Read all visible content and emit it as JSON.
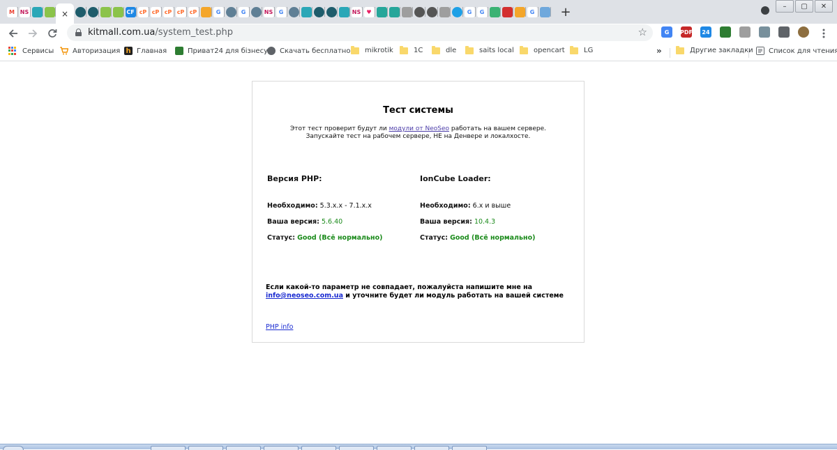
{
  "browser": {
    "active_tab_close": "×",
    "new_tab": "+",
    "window_buttons": [
      "–",
      "▢",
      "✕"
    ],
    "tabs": [
      {
        "icon": "gmail-icon",
        "letter": "M",
        "color": "#ea4335",
        "bg": "#ffffff"
      },
      {
        "icon": "ns-icon",
        "letter": "NS",
        "color": "#c2185b",
        "bg": "#ffffff"
      },
      {
        "icon": "tab-page-icon",
        "letter": "",
        "color": "#ffffff",
        "bg": "#2aa7b7"
      },
      {
        "icon": "puzzle-icon",
        "letter": "",
        "color": "#ffffff",
        "bg": "#8bc34a"
      },
      {
        "icon": "globe-icon",
        "letter": "",
        "color": "#ffffff",
        "bg": "#1e5c6b"
      },
      {
        "icon": "globe-icon",
        "letter": "",
        "color": "#ffffff",
        "bg": "#1e5c6b"
      },
      {
        "icon": "puzzle-icon",
        "letter": "",
        "color": "#ffffff",
        "bg": "#8bc34a"
      },
      {
        "icon": "puzzle-icon",
        "letter": "",
        "color": "#ffffff",
        "bg": "#8bc34a"
      },
      {
        "icon": "cr-icon",
        "letter": "CF",
        "color": "#ffffff",
        "bg": "#1e88e5"
      },
      {
        "icon": "cp-icon",
        "letter": "cP",
        "color": "#ff6c2c",
        "bg": "#ffffff"
      },
      {
        "icon": "cp-icon",
        "letter": "cP",
        "color": "#ff6c2c",
        "bg": "#ffffff"
      },
      {
        "icon": "cp-icon",
        "letter": "cP",
        "color": "#ff6c2c",
        "bg": "#ffffff"
      },
      {
        "icon": "cp-icon",
        "letter": "cP",
        "color": "#ff6c2c",
        "bg": "#ffffff"
      },
      {
        "icon": "cp-icon",
        "letter": "cP",
        "color": "#ff6c2c",
        "bg": "#ffffff"
      },
      {
        "icon": "chart-icon",
        "letter": "",
        "color": "#ffffff",
        "bg": "#f4a62a"
      },
      {
        "icon": "google-icon",
        "letter": "G",
        "color": "#4285f4",
        "bg": "#ffffff"
      },
      {
        "icon": "globe-icon",
        "letter": "",
        "color": "#ffffff",
        "bg": "#5f7f95"
      },
      {
        "icon": "google-icon",
        "letter": "G",
        "color": "#4285f4",
        "bg": "#ffffff"
      },
      {
        "icon": "globe-icon",
        "letter": "",
        "color": "#ffffff",
        "bg": "#5f7f95"
      },
      {
        "icon": "ns-icon",
        "letter": "NS",
        "color": "#c2185b",
        "bg": "#ffffff"
      },
      {
        "icon": "google-icon",
        "letter": "G",
        "color": "#4285f4",
        "bg": "#ffffff"
      },
      {
        "icon": "globe-icon",
        "letter": "",
        "color": "#ffffff",
        "bg": "#5f7f95"
      },
      {
        "icon": "tab-page-icon",
        "letter": "",
        "color": "#ffffff",
        "bg": "#2aa7b7"
      },
      {
        "icon": "globe-icon",
        "letter": "",
        "color": "#ffffff",
        "bg": "#1e5c6b"
      },
      {
        "icon": "globe-icon",
        "letter": "",
        "color": "#ffffff",
        "bg": "#1e5c6b"
      },
      {
        "icon": "tab-page-icon",
        "letter": "",
        "color": "#ffffff",
        "bg": "#2aa7b7"
      },
      {
        "icon": "ns-icon",
        "letter": "NS",
        "color": "#c2185b",
        "bg": "#ffffff"
      },
      {
        "icon": "heart-icon",
        "letter": "♥",
        "color": "#e91e63",
        "bg": "#ffffff"
      },
      {
        "icon": "chat-icon",
        "letter": "",
        "color": "#ffffff",
        "bg": "#26a69a"
      },
      {
        "icon": "chat-icon",
        "letter": "",
        "color": "#ffffff",
        "bg": "#26a69a"
      },
      {
        "icon": "cart-icon",
        "letter": "",
        "color": "#ffffff",
        "bg": "#9e9e9e"
      },
      {
        "icon": "globe-icon",
        "letter": "",
        "color": "#ffffff",
        "bg": "#555555"
      },
      {
        "icon": "globe-icon",
        "letter": "",
        "color": "#ffffff",
        "bg": "#555555"
      },
      {
        "icon": "cart-icon",
        "letter": "",
        "color": "#ffffff",
        "bg": "#9e9e9e"
      },
      {
        "icon": "circle-icon",
        "letter": "",
        "color": "#ffffff",
        "bg": "#1ea0e6"
      },
      {
        "icon": "google-icon",
        "letter": "G",
        "color": "#4285f4",
        "bg": "#ffffff"
      },
      {
        "icon": "google-icon",
        "letter": "G",
        "color": "#4285f4",
        "bg": "#ffffff"
      },
      {
        "icon": "translate-icon",
        "letter": "",
        "color": "#ffffff",
        "bg": "#3bb273"
      },
      {
        "icon": "dots-icon",
        "letter": "",
        "color": "#ffffff",
        "bg": "#d32f2f"
      },
      {
        "icon": "chart-icon",
        "letter": "",
        "color": "#ffffff",
        "bg": "#f4a62a"
      },
      {
        "icon": "google-icon",
        "letter": "G",
        "color": "#4285f4",
        "bg": "#ffffff"
      },
      {
        "icon": "cart-icon",
        "letter": "",
        "color": "#ffffff",
        "bg": "#6fa8dc"
      }
    ],
    "url_host": "kitmall.com.ua",
    "url_path": "/system_test.php",
    "extensions": [
      {
        "icon": "translate-icon",
        "letter": "G",
        "bg": "#4285f4"
      },
      {
        "icon": "pdf-icon",
        "letter": "PDF",
        "bg": "#c62828"
      },
      {
        "icon": "bitrix24-icon",
        "letter": "24",
        "bg": "#1e88e5"
      },
      {
        "icon": "privat-icon",
        "letter": "",
        "bg": "#2e7d32"
      },
      {
        "icon": "pipette-icon",
        "letter": "",
        "bg": "#9e9e9e"
      },
      {
        "icon": "reader-icon",
        "letter": "",
        "bg": "#78909c"
      },
      {
        "icon": "puzzle-icon",
        "letter": "",
        "bg": "#5f6368"
      },
      {
        "icon": "avatar-icon",
        "letter": "",
        "bg": "#8d6e3f"
      }
    ]
  },
  "bookmarks": {
    "items": [
      {
        "label": "Сервисы",
        "icon": "apps-icon"
      },
      {
        "label": "Авторизация",
        "icon": "cart-icon"
      },
      {
        "label": "Главная",
        "icon": "h-icon"
      },
      {
        "label": "Приват24 для бізнесу",
        "icon": "privat-icon"
      },
      {
        "label": "Скачать бесплатно",
        "icon": "globe-icon"
      },
      {
        "label": "mikrotik",
        "icon": "folder-icon"
      },
      {
        "label": "1C",
        "icon": "folder-icon"
      },
      {
        "label": "dle",
        "icon": "folder-icon"
      },
      {
        "label": "saits local",
        "icon": "folder-icon"
      },
      {
        "label": "opencart",
        "icon": "folder-icon"
      },
      {
        "label": "LG",
        "icon": "folder-icon"
      }
    ],
    "overflow": "»",
    "other": "Другие закладки",
    "reading_list": "Список для чтения"
  },
  "page": {
    "title": "Тест системы",
    "intro_before": "Этот тест проверит будут ли ",
    "intro_link": "модули от NeoSeo",
    "intro_after": " работать на вашем сервере.",
    "intro_line2": "Запускайте тест на рабочем сервере, НЕ на Денвере и локалхосте.",
    "php": {
      "heading": "Версия PHP:",
      "required_label": "Необходимо:",
      "required_value": "5.3.x.x - 7.1.x.x",
      "version_label": "Ваша версия:",
      "version_value": "5.6.40",
      "status_label": "Статус:",
      "status_value": "Good (Всё нормально)"
    },
    "ioncube": {
      "heading": "IonCube Loader:",
      "required_label": "Необходимо:",
      "required_value": "6.x и выше",
      "version_label": "Ваша версия:",
      "version_value": "10.4.3",
      "status_label": "Статус:",
      "status_value": "Good (Всё нормально)"
    },
    "notice_line1": "Если какой-то параметр не совпадает, пожалуйста напишите мне на",
    "notice_email": "info@neoseo.com.ua",
    "notice_after": " и уточните будет ли модуль работать на вашей системе",
    "php_info_link": "PHP info"
  },
  "colors": {
    "status_good": "#1a8a1a",
    "link": "#1a2bd1",
    "visited_link": "#4b3ca8"
  }
}
